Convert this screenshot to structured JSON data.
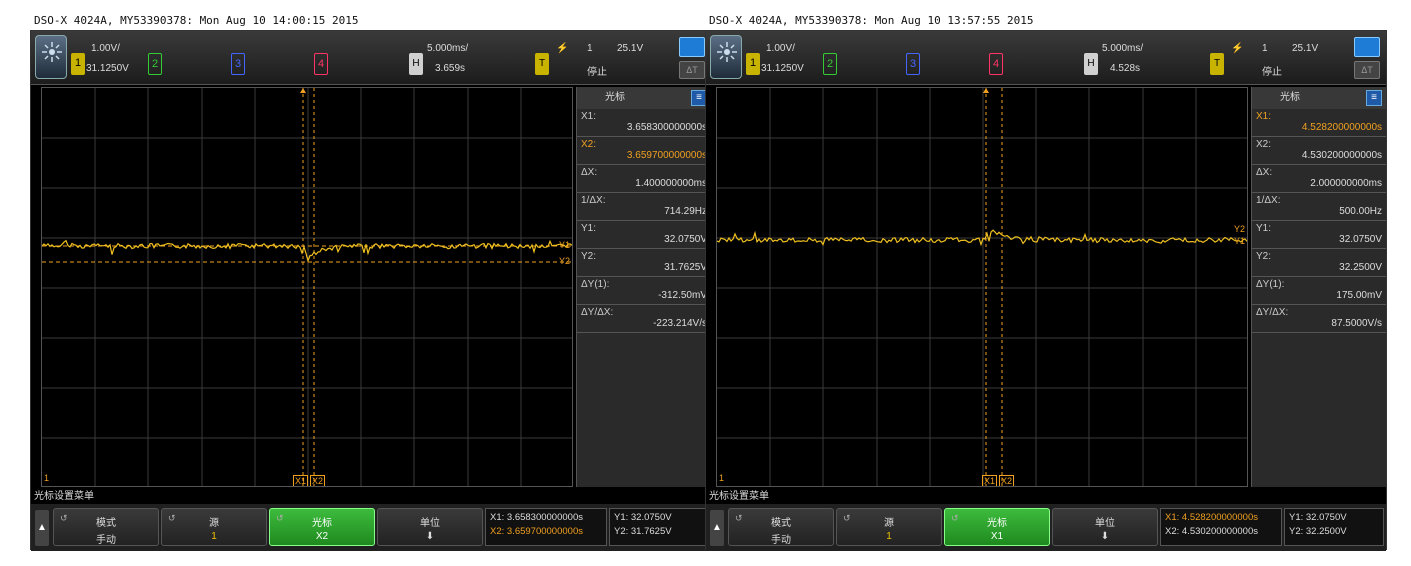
{
  "left": {
    "title": "DSO-X 4024A, MY53390378: Mon Aug 10 14:00:15 2015",
    "ch1_scale": "1.00V/",
    "ch1_offset": "31.1250V",
    "ch1_label": "1",
    "ch2_label": "2",
    "ch3_label": "3",
    "ch4_label": "4",
    "h_label": "H",
    "time_scale": "5.000ms/",
    "time_delay": "3.659s",
    "t_label": "T",
    "trig_source": "1",
    "trig_level": "25.1V",
    "run_status": "停止",
    "panel_title": "光标",
    "rows": [
      {
        "label": "X1:",
        "value": "3.658300000000s",
        "hl": false
      },
      {
        "label": "X2:",
        "value": "3.659700000000s",
        "hl": true
      },
      {
        "label": "ΔX:",
        "value": "1.400000000ms",
        "hl": false
      },
      {
        "label": "1/ΔX:",
        "value": "714.29Hz",
        "hl": false
      },
      {
        "label": "Y1:",
        "value": "32.0750V",
        "hl": false
      },
      {
        "label": "Y2:",
        "value": "31.7625V",
        "hl": false
      },
      {
        "label": "ΔY(1):",
        "value": "-312.50mV",
        "hl": false
      },
      {
        "label": "ΔY/ΔX:",
        "value": "-223.214V/s",
        "hl": false
      }
    ],
    "menu_title": "光标设置菜单",
    "sk_mode": "模式",
    "sk_mode_val": "手动",
    "sk_source": "源",
    "sk_source_val": "1",
    "sk_cursor": "光标",
    "sk_cursor_val": "X2",
    "sk_unit": "单位",
    "readout_x1": "X1: 3.658300000000s",
    "readout_x2": "X2: 3.659700000000s",
    "readout_y1": "Y1: 32.0750V",
    "readout_y2": "Y2: 31.7625V",
    "cursor_labels": [
      "X1",
      "X2"
    ],
    "marker_y1": "Y1",
    "marker_y2": "Y2",
    "ground_marker": "1"
  },
  "right": {
    "title": "DSO-X 4024A, MY53390378: Mon Aug 10 13:57:55 2015",
    "ch1_scale": "1.00V/",
    "ch1_offset": "31.1250V",
    "ch1_label": "1",
    "ch2_label": "2",
    "ch3_label": "3",
    "ch4_label": "4",
    "h_label": "H",
    "time_scale": "5.000ms/",
    "time_delay": "4.528s",
    "t_label": "T",
    "trig_source": "1",
    "trig_level": "25.1V",
    "run_status": "停止",
    "panel_title": "光标",
    "rows": [
      {
        "label": "X1:",
        "value": "4.528200000000s",
        "hl": true
      },
      {
        "label": "X2:",
        "value": "4.530200000000s",
        "hl": false
      },
      {
        "label": "ΔX:",
        "value": "2.000000000ms",
        "hl": false
      },
      {
        "label": "1/ΔX:",
        "value": "500.00Hz",
        "hl": false
      },
      {
        "label": "Y1:",
        "value": "32.0750V",
        "hl": false
      },
      {
        "label": "Y2:",
        "value": "32.2500V",
        "hl": false
      },
      {
        "label": "ΔY(1):",
        "value": "175.00mV",
        "hl": false
      },
      {
        "label": "ΔY/ΔX:",
        "value": "87.5000V/s",
        "hl": false
      }
    ],
    "menu_title": "光标设置菜单",
    "sk_mode": "模式",
    "sk_mode_val": "手动",
    "sk_source": "源",
    "sk_source_val": "1",
    "sk_cursor": "光标",
    "sk_cursor_val": "X1",
    "sk_unit": "单位",
    "readout_x1": "X1: 4.528200000000s",
    "readout_x2": "X2: 4.530200000000s",
    "readout_y1": "Y1: 32.0750V",
    "readout_y2": "Y2: 32.2500V",
    "cursor_labels": [
      "X1",
      "X2"
    ],
    "marker_y1": "Y1",
    "marker_y2": "Y2",
    "ground_marker": "1"
  },
  "colors": {
    "trace": "#f0c020",
    "cursor": "#f0a020",
    "accent": "#1e7bd6",
    "active_key": "#2fa82f"
  },
  "icons": [
    "scope-logo-icon",
    "up-arrow-icon",
    "down-arrow-icon",
    "rotate-icon",
    "menu-icon",
    "trigger-edge-icon"
  ]
}
